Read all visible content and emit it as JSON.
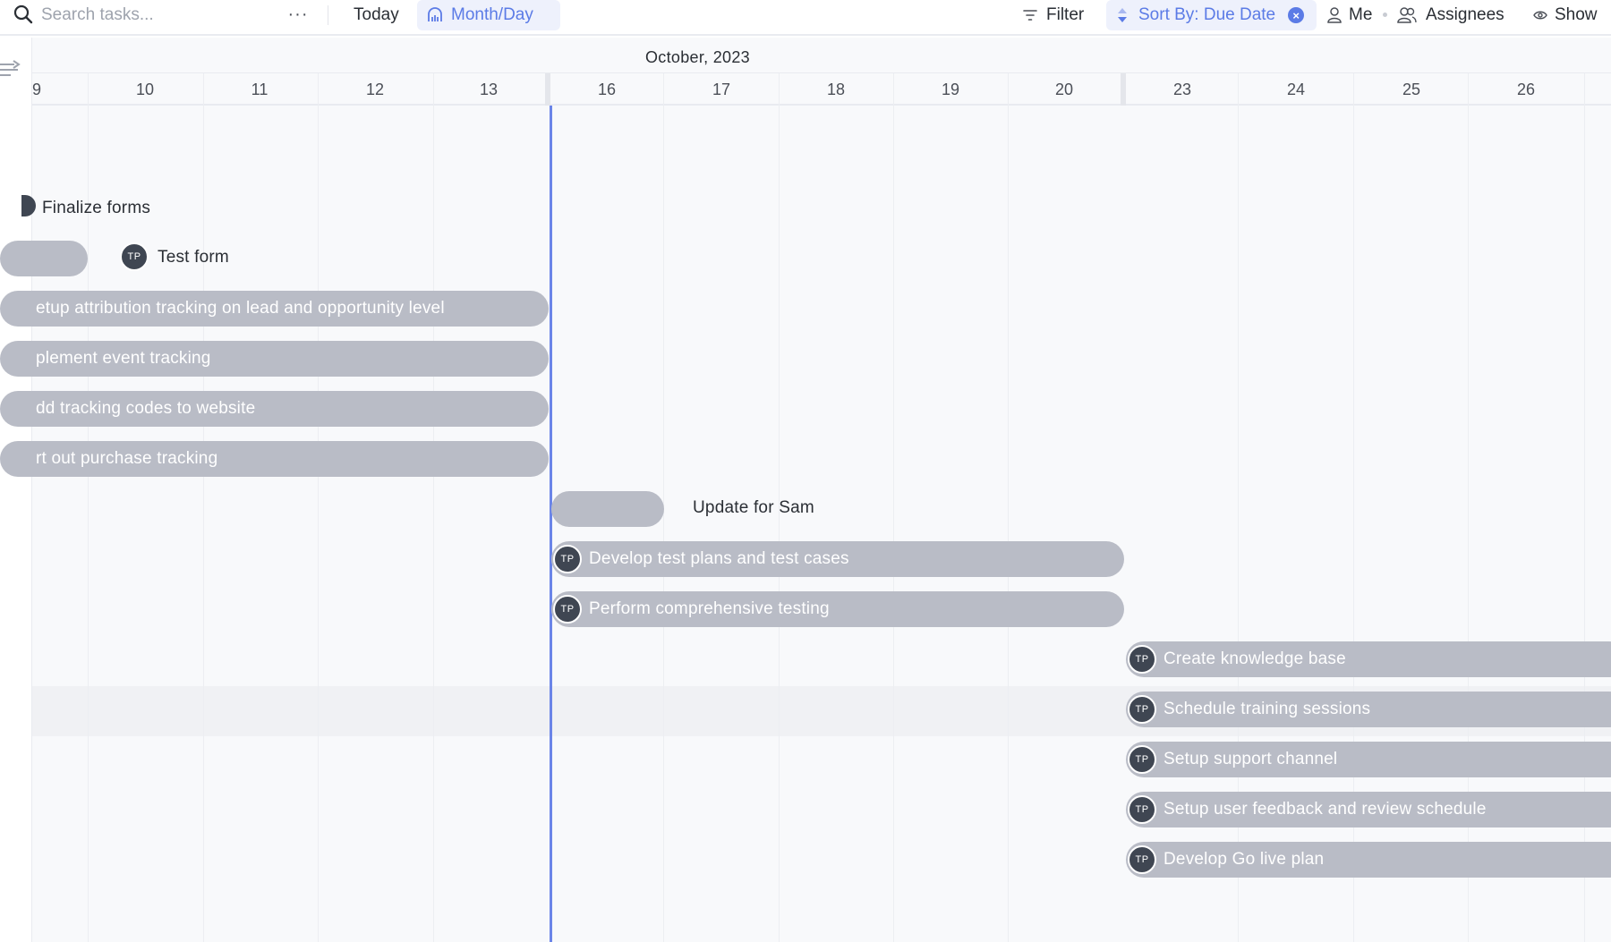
{
  "toolbar": {
    "search_placeholder": "Search tasks...",
    "more_label": "···",
    "today_label": "Today",
    "view_label": "Month/Day",
    "filter_label": "Filter",
    "sort_label": "Sort By: Due Date",
    "sort_clear": "×",
    "me_label": "Me",
    "assignees_label": "Assignees",
    "show_label": "Show"
  },
  "timeline": {
    "month": "October, 2023",
    "days": [
      "9",
      "10",
      "11",
      "12",
      "13",
      "16",
      "17",
      "18",
      "19",
      "20",
      "23",
      "24",
      "25",
      "26"
    ],
    "today": "16"
  },
  "tasks": [
    {
      "name": "Finalize forms",
      "style": "plain"
    },
    {
      "name": "Test form",
      "assignee": "TP",
      "style": "plain"
    },
    {
      "name": "Setup attribution tracking on lead and opportunity level",
      "visible_text": "etup attribution tracking on lead and opportunity level"
    },
    {
      "name": "Implement event tracking",
      "visible_text": "plement event tracking"
    },
    {
      "name": "Add tracking codes to website",
      "visible_text": "dd tracking codes to website"
    },
    {
      "name": "Sort out purchase tracking",
      "visible_text": "rt out purchase tracking"
    },
    {
      "name": "Update for Sam",
      "style": "plain"
    },
    {
      "name": "Develop test plans and test cases",
      "assignee": "TP"
    },
    {
      "name": "Perform comprehensive testing",
      "assignee": "TP"
    },
    {
      "name": "Create knowledge base",
      "assignee": "TP"
    },
    {
      "name": "Schedule training sessions",
      "assignee": "TP"
    },
    {
      "name": "Setup support channel",
      "assignee": "TP"
    },
    {
      "name": "Setup user feedback and review schedule",
      "assignee": "TP"
    },
    {
      "name": "Develop Go live plan",
      "assignee": "TP"
    }
  ],
  "colors": {
    "bar": "#b9bcc6",
    "accent": "#5b7be6",
    "today_line": "#6b85e8",
    "avatar": "#3f4652"
  }
}
